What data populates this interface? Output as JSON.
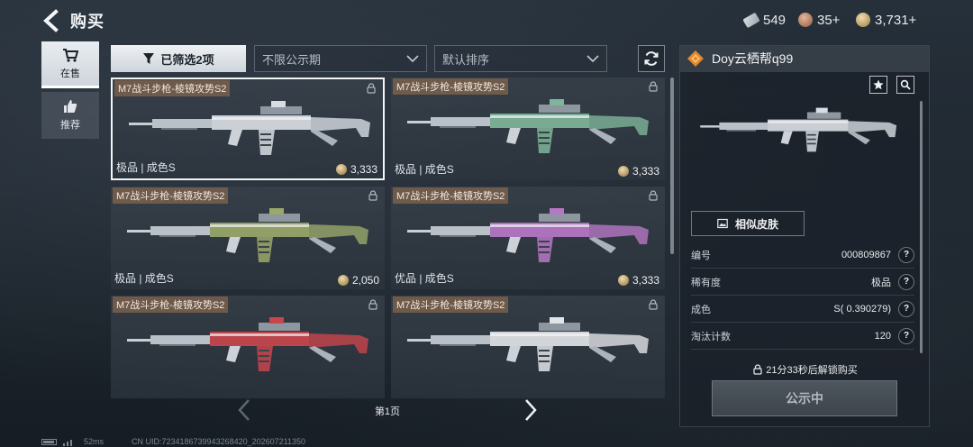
{
  "header": {
    "title": "购买",
    "back_icon": "back-arrow-icon"
  },
  "currencies": [
    {
      "icon": "ticket-icon",
      "value": "549"
    },
    {
      "icon": "bronze-coin-icon",
      "value": "35+"
    },
    {
      "icon": "gold-coin-icon",
      "value": "3,731+"
    }
  ],
  "sidebar": {
    "items": [
      {
        "label": "在售",
        "icon": "cart-icon",
        "active": true
      },
      {
        "label": "推荐",
        "icon": "thumbs-up-icon",
        "active": false
      }
    ]
  },
  "filters": {
    "filter_button_label": "已筛选2项",
    "public_period": "不限公示期",
    "sort": "默认排序"
  },
  "items": [
    {
      "name": "M7战斗步枪-棱镜攻势S2",
      "grade": "极品 | 成色S",
      "price": "3,333",
      "accent": "#d8dde3",
      "selected": true
    },
    {
      "name": "M7战斗步枪-棱镜攻势S2",
      "grade": "极品 | 成色S",
      "price": "3,333",
      "accent": "#7fb59a",
      "selected": false
    },
    {
      "name": "M7战斗步枪-棱镜攻势S2",
      "grade": "极品 | 成色S",
      "price": "2,050",
      "accent": "#9aa86a",
      "selected": false
    },
    {
      "name": "M7战斗步枪-棱镜攻势S2",
      "grade": "优品 | 成色S",
      "price": "3,333",
      "accent": "#b777c6",
      "selected": false
    },
    {
      "name": "M7战斗步枪-棱镜攻势S2",
      "grade": "",
      "price": "",
      "accent": "#c9454c",
      "selected": false
    },
    {
      "name": "M7战斗步枪-棱镜攻势S2",
      "grade": "",
      "price": "",
      "accent": "#e2e4e6",
      "selected": false
    }
  ],
  "pager": {
    "label": "第1页"
  },
  "detail": {
    "seller": "Doy云栖帮q99",
    "similar_button_label": "相似皮肤",
    "attributes": [
      {
        "label": "编号",
        "value": "000809867"
      },
      {
        "label": "稀有度",
        "value": "极品"
      },
      {
        "label": "成色",
        "value": "S( 0.390279)"
      },
      {
        "label": "淘汰计数",
        "value": "120"
      }
    ],
    "unlock_note": "21分33秒后解锁购买",
    "buy_button_label": "公示中"
  },
  "footer": {
    "ping": "52ms",
    "uid": "CN UID:7234186739943268420_202607211350"
  }
}
